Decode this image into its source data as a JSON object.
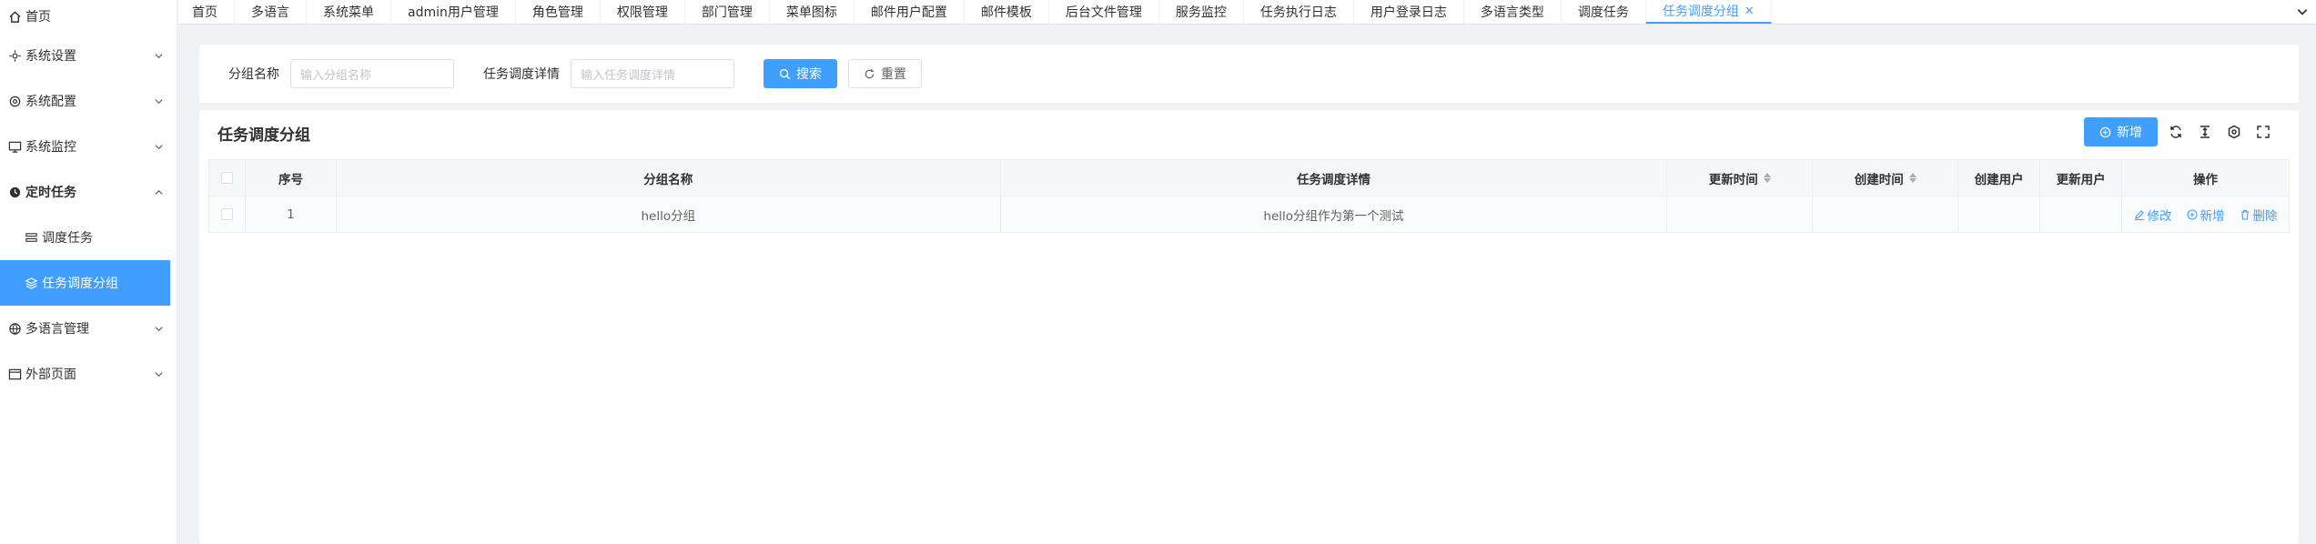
{
  "sidebar": {
    "items": [
      {
        "label": "首页",
        "icon": "home-icon"
      },
      {
        "label": "系统设置",
        "icon": "settings-icon"
      },
      {
        "label": "系统配置",
        "icon": "gear-icon"
      },
      {
        "label": "系统监控",
        "icon": "monitor-icon"
      },
      {
        "label": "定时任务",
        "icon": "clock-icon"
      },
      {
        "label": "调度任务",
        "icon": "tasks-icon"
      },
      {
        "label": "任务调度分组",
        "icon": "layers-icon"
      },
      {
        "label": "多语言管理",
        "icon": "globe-icon"
      },
      {
        "label": "外部页面",
        "icon": "window-icon"
      }
    ]
  },
  "tabs": [
    {
      "label": "首页"
    },
    {
      "label": "多语言"
    },
    {
      "label": "系统菜单"
    },
    {
      "label": "admin用户管理"
    },
    {
      "label": "角色管理"
    },
    {
      "label": "权限管理"
    },
    {
      "label": "部门管理"
    },
    {
      "label": "菜单图标"
    },
    {
      "label": "邮件用户配置"
    },
    {
      "label": "邮件模板"
    },
    {
      "label": "后台文件管理"
    },
    {
      "label": "服务监控"
    },
    {
      "label": "任务执行日志"
    },
    {
      "label": "用户登录日志"
    },
    {
      "label": "多语言类型"
    },
    {
      "label": "调度任务"
    },
    {
      "label": "任务调度分组"
    }
  ],
  "search": {
    "group_name_label": "分组名称",
    "group_name_placeholder": "输入分组名称",
    "detail_label": "任务调度详情",
    "detail_placeholder": "输入任务调度详情",
    "search_button": "搜索",
    "reset_button": "重置"
  },
  "table": {
    "title": "任务调度分组",
    "add_button": "新增",
    "columns": {
      "index": "序号",
      "group_name": "分组名称",
      "detail": "任务调度详情",
      "updated_at": "更新时间",
      "created_at": "创建时间",
      "created_by": "创建用户",
      "updated_by": "更新用户",
      "actions": "操作"
    },
    "rows": [
      {
        "index": "1",
        "group_name": "hello分组",
        "detail": "hello分组作为第一个测试",
        "updated_at": "",
        "created_at": "",
        "created_by": "",
        "updated_by": "",
        "edit": "修改",
        "add": "新增",
        "delete": "删除"
      }
    ]
  },
  "colors": {
    "primary": "#409eff",
    "text": "#303133",
    "border": "#ebeef5"
  }
}
